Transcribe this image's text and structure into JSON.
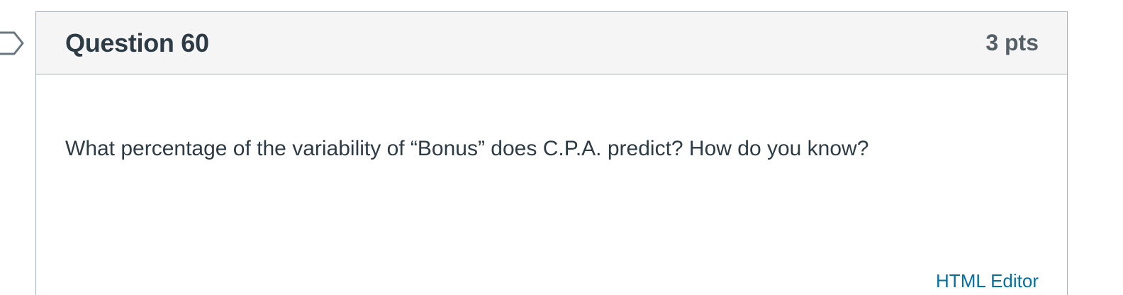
{
  "question": {
    "title": "Question 60",
    "points": "3 pts",
    "text": "What percentage of the variability of “Bonus” does C.P.A. predict? How do you know?"
  },
  "editor": {
    "html_editor_label": "HTML Editor"
  },
  "icons": {
    "flag": "flag-question-icon"
  },
  "colors": {
    "header_background": "#f5f5f5",
    "border": "#a9b0b6",
    "text": "#2d3b45",
    "points_text": "#555f66",
    "link": "#0770a3"
  }
}
